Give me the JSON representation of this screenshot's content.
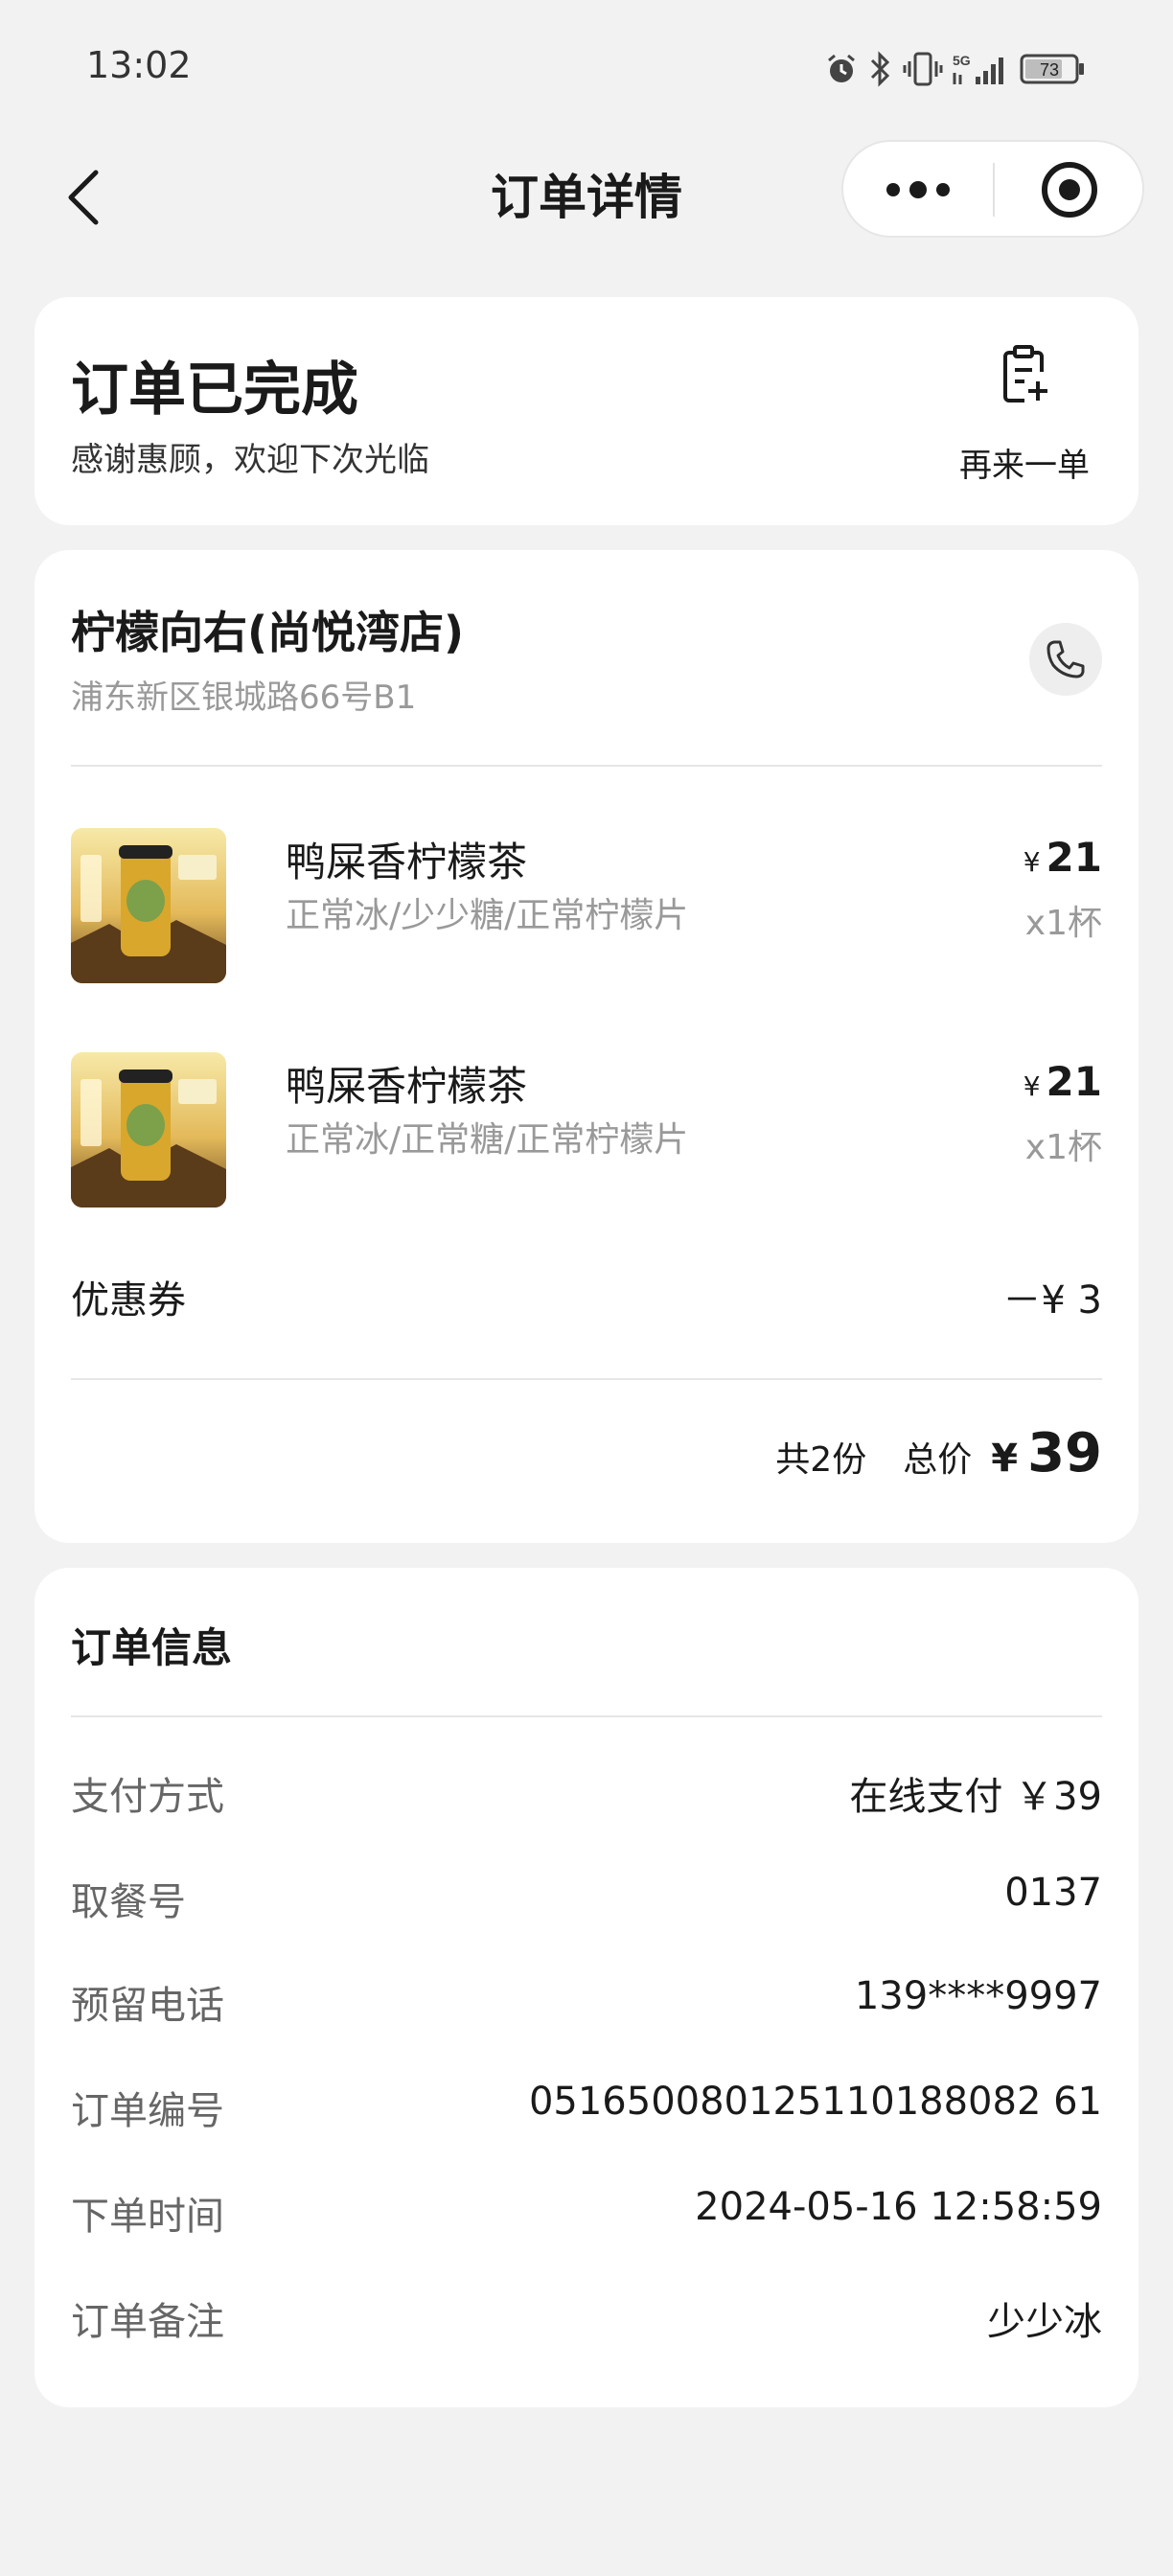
{
  "status_bar": {
    "time": "13:02",
    "battery": "73",
    "network": "5G"
  },
  "nav": {
    "title": "订单详情"
  },
  "order_status": {
    "title": "订单已完成",
    "subtitle": "感谢惠顾，欢迎下次光临",
    "reorder_label": "再来一单"
  },
  "shop": {
    "name": "柠檬向右(尚悦湾店)",
    "address": "浦东新区银城路66号B1"
  },
  "items": [
    {
      "name": "鸭屎香柠檬茶",
      "spec": "正常冰/少少糖/正常柠檬片",
      "currency": "¥",
      "price": "21",
      "qty": "x1杯"
    },
    {
      "name": "鸭屎香柠檬茶",
      "spec": "正常冰/正常糖/正常柠檬片",
      "currency": "¥",
      "price": "21",
      "qty": "x1杯"
    }
  ],
  "coupon": {
    "label": "优惠券",
    "value": "－¥ 3"
  },
  "total": {
    "count": "共2份",
    "label": "总价",
    "currency": "¥",
    "price": "39"
  },
  "order_info": {
    "title": "订单信息",
    "rows": [
      {
        "label": "支付方式",
        "value": "在线支付 ￥39"
      },
      {
        "label": "取餐号",
        "value": "0137"
      },
      {
        "label": "预留电话",
        "value": "139****9997"
      },
      {
        "label": "订单编号",
        "value": "051650080125110188082 61"
      },
      {
        "label": "下单时间",
        "value": "2024-05-16 12:58:59"
      },
      {
        "label": "订单备注",
        "value": "少少冰"
      }
    ]
  },
  "colors": {
    "background": "#f2f2f2",
    "card": "#ffffff",
    "primary_text": "#1a1a1a",
    "secondary_text": "#999999",
    "product_yellow": "#e8c34a"
  }
}
